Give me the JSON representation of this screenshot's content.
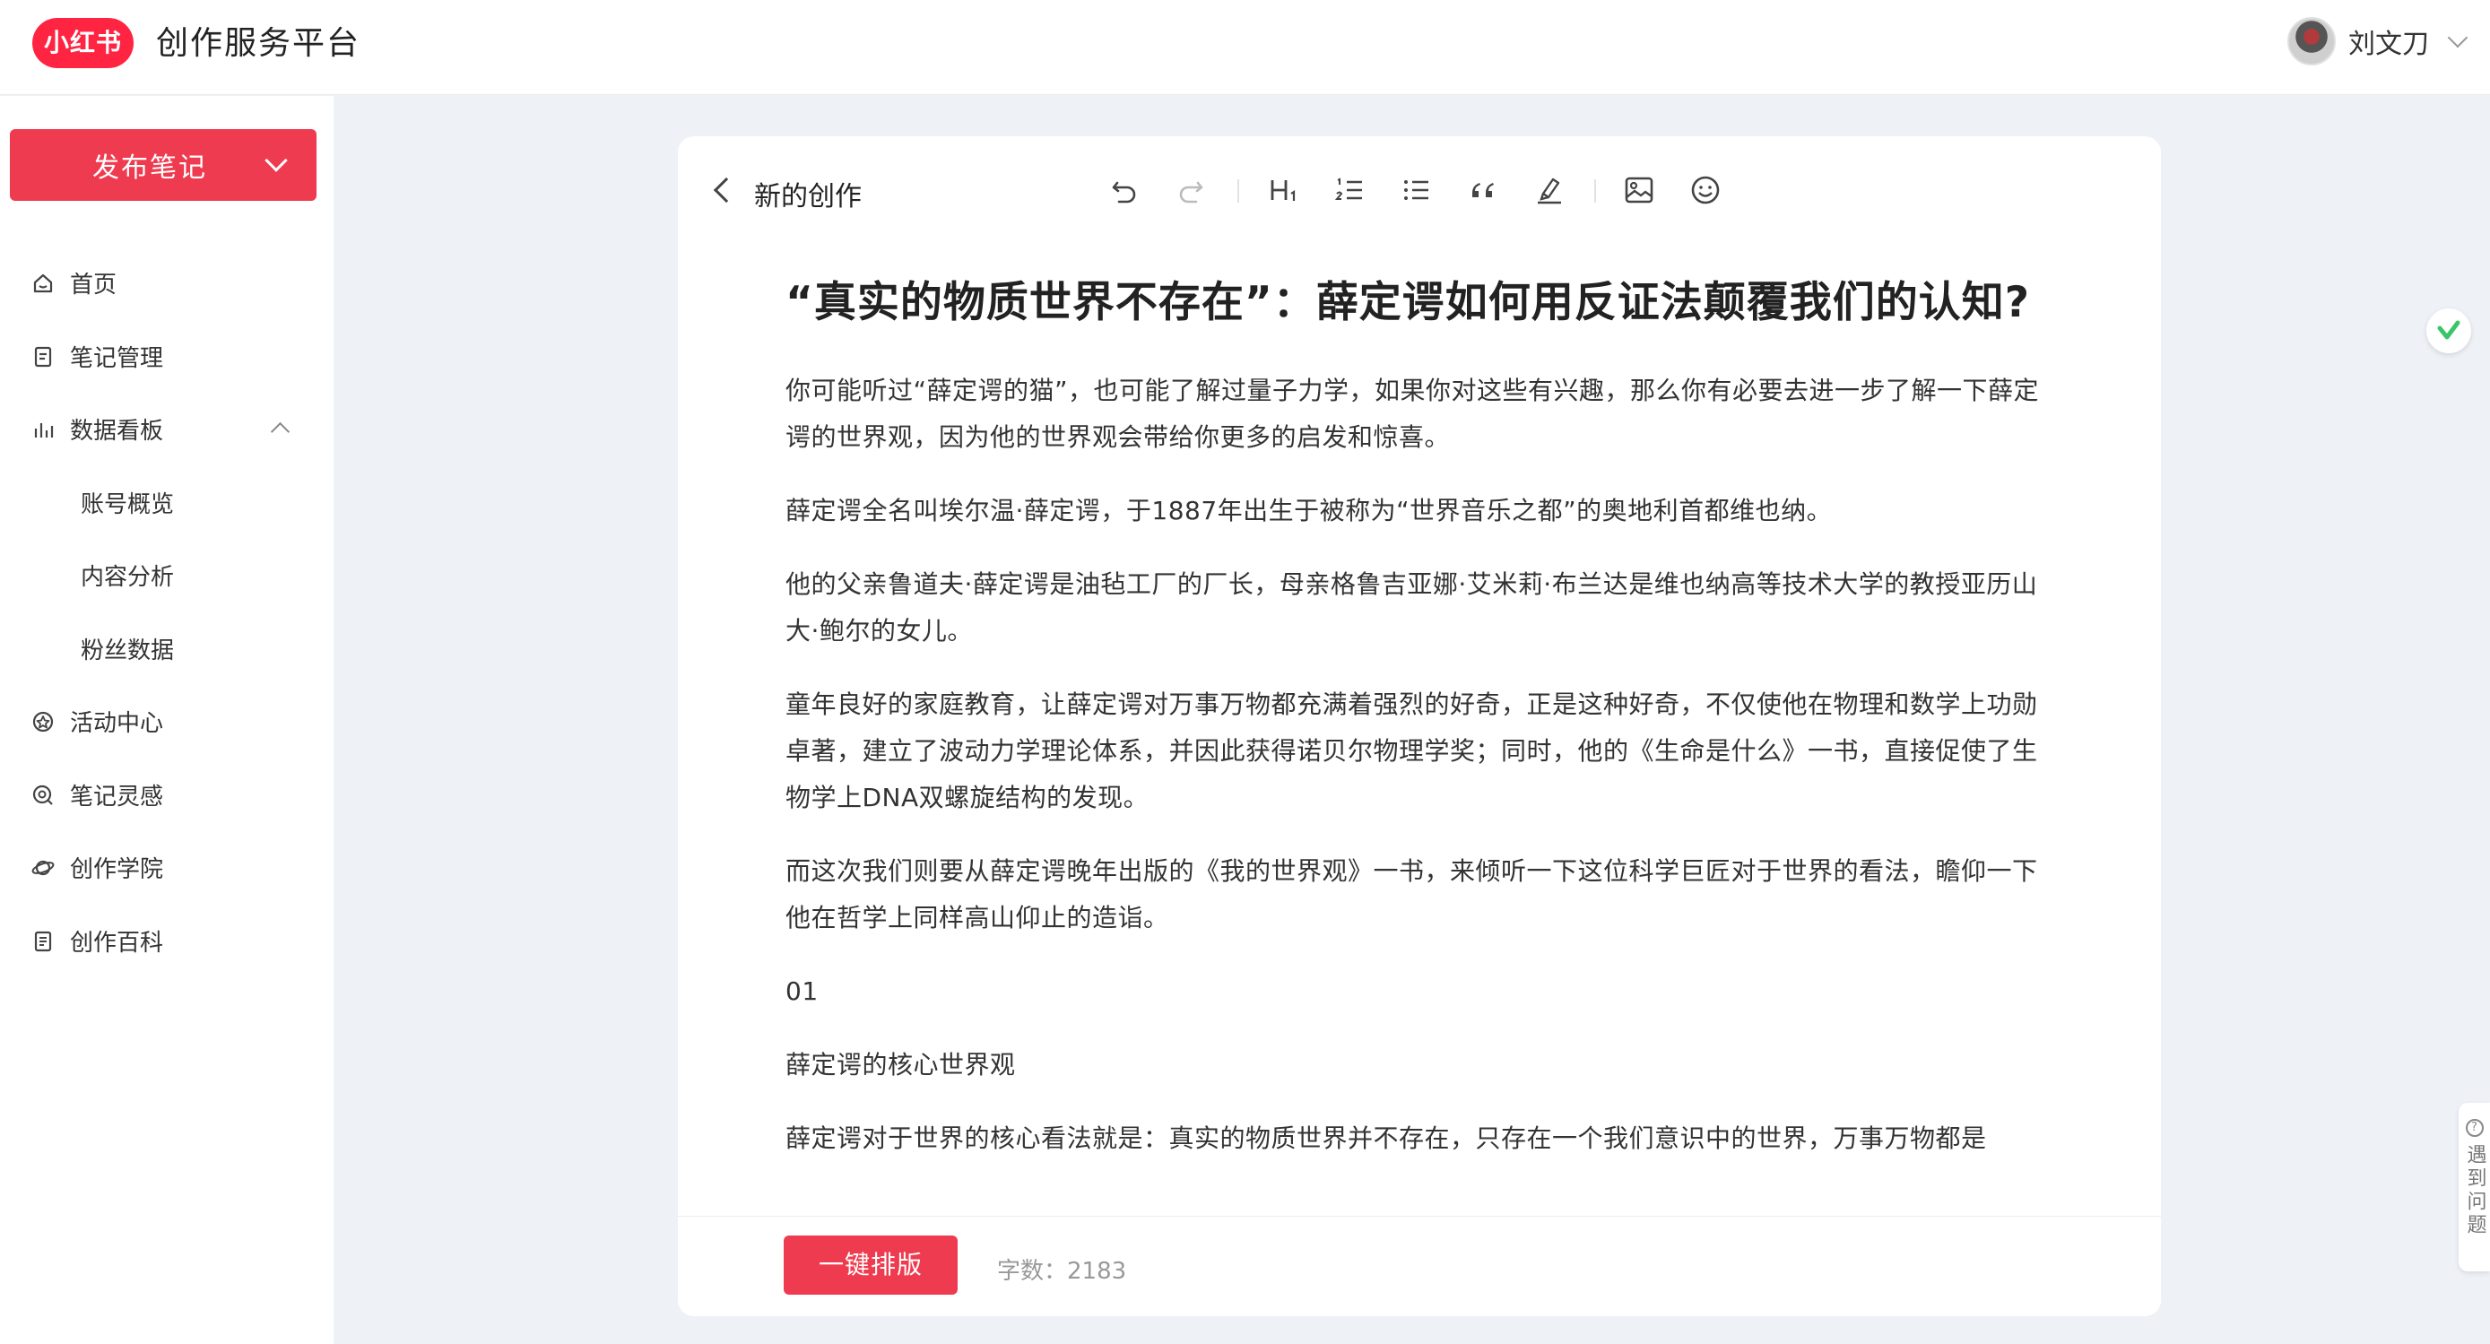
{
  "header": {
    "logo_text": "小红书",
    "platform_title": "创作服务平台",
    "user_name": "刘文刀"
  },
  "sidebar": {
    "publish_label": "发布笔记",
    "items": [
      {
        "label": "首页",
        "icon": "home-icon"
      },
      {
        "label": "笔记管理",
        "icon": "note-icon"
      },
      {
        "label": "数据看板",
        "icon": "bar-chart-icon",
        "expanded": true
      },
      {
        "label": "账号概览",
        "sub": true
      },
      {
        "label": "内容分析",
        "sub": true
      },
      {
        "label": "粉丝数据",
        "sub": true
      },
      {
        "label": "活动中心",
        "icon": "activity-icon"
      },
      {
        "label": "笔记灵感",
        "icon": "inspiration-icon"
      },
      {
        "label": "创作学院",
        "icon": "planet-icon"
      },
      {
        "label": "创作百科",
        "icon": "book-icon"
      }
    ]
  },
  "editor": {
    "doc_label": "新的创作",
    "toolbar_icons": [
      "undo-icon",
      "redo-icon",
      "heading-icon",
      "ordered-list-icon",
      "bullet-list-icon",
      "quote-icon",
      "highlight-icon",
      "image-icon",
      "emoji-icon"
    ],
    "title": "“真实的物质世界不存在”：薛定谔如何用反证法颠覆我们的认知?",
    "paragraphs": [
      "你可能听过“薛定谔的猫”，也可能了解过量子力学，如果你对这些有兴趣，那么你有必要去进一步了解一下薛定谔的世界观，因为他的世界观会带给你更多的启发和惊喜。",
      "薛定谔全名叫埃尔温·薛定谔，于1887年出生于被称为“世界音乐之都”的奥地利首都维也纳。",
      "他的父亲鲁道夫·薛定谔是油毡工厂的厂长，母亲格鲁吉亚娜·艾米莉·布兰达是维也纳高等技术大学的教授亚历山大·鲍尔的女儿。",
      "童年良好的家庭教育，让薛定谔对万事万物都充满着强烈的好奇，正是这种好奇，不仅使他在物理和数学上功勋卓著，建立了波动力学理论体系，并因此获得诺贝尔物理学奖；同时，他的《生命是什么》一书，直接促使了生物学上DNA双螺旋结构的发现。",
      "而这次我们则要从薛定谔晚年出版的《我的世界观》一书，来倾听一下这位科学巨匠对于世界的看法，瞻仰一下他在哲学上同样高山仰止的造诣。",
      "01",
      "薛定谔的核心世界观",
      "薛定谔对于世界的核心看法就是：真实的物质世界并不存在，只存在一个我们意识中的世界，万事万物都是"
    ],
    "format_button": "一键排版",
    "word_count": "字数：2183"
  },
  "help_tab": "遇到问题"
}
